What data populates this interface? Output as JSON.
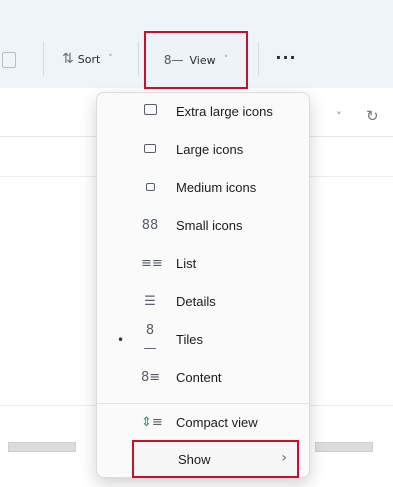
{
  "toolbar": {
    "sort_label": "Sort",
    "view_label": "View",
    "more_label": "···"
  },
  "view_menu": {
    "items": [
      {
        "label": "Extra large icons",
        "icon": "extra-large-icons-icon"
      },
      {
        "label": "Large icons",
        "icon": "large-icons-icon"
      },
      {
        "label": "Medium icons",
        "icon": "medium-icons-icon"
      },
      {
        "label": "Small icons",
        "icon": "small-icons-icon"
      },
      {
        "label": "List",
        "icon": "list-icon"
      },
      {
        "label": "Details",
        "icon": "details-icon"
      },
      {
        "label": "Tiles",
        "icon": "tiles-icon",
        "selected": true
      },
      {
        "label": "Content",
        "icon": "content-icon"
      }
    ],
    "compact_label": "Compact view",
    "show_label": "Show"
  },
  "colors": {
    "highlight_border": "#c8102e",
    "toolbar_bg": "#eff4f9",
    "menu_bg": "#fafafa"
  }
}
